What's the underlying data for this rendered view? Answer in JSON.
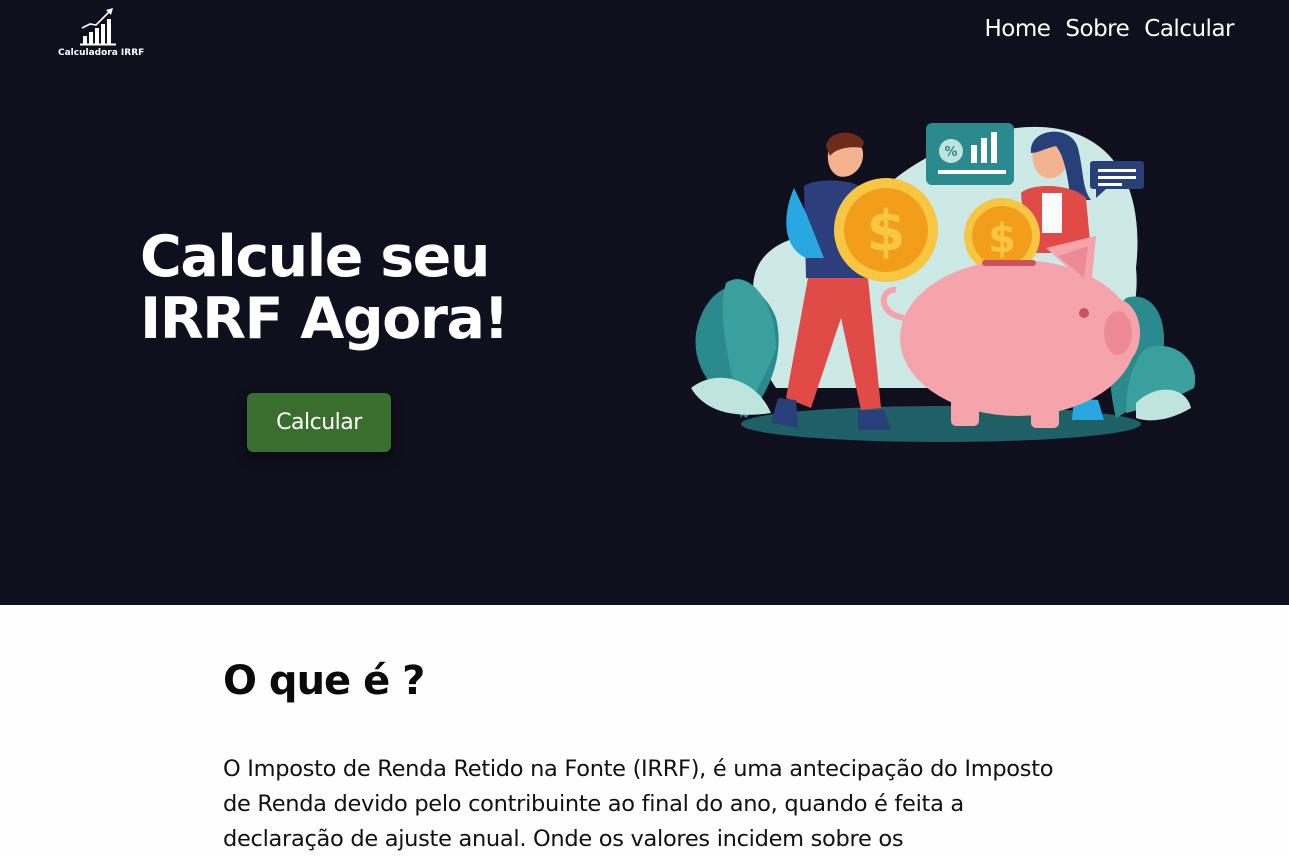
{
  "header": {
    "logo_text": "Calculadora IRRF",
    "logo_icon": "bar-chart-growth-icon",
    "nav": [
      "Home",
      "Sobre",
      "Calcular"
    ]
  },
  "hero": {
    "title": "Calcule seu IRRF Agora!",
    "button_label": "Calcular",
    "background": "#0f0f1e",
    "button_color": "#3a6e2e"
  },
  "section": {
    "title": "O que é ?",
    "body": "O Imposto de Renda Retido na Fonte (IRRF), é uma antecipação do Imposto de Renda devido pelo contribuinte ao final do ano, quando é feita a declaração de ajuste anual. Onde os valores incidem sobre os"
  }
}
